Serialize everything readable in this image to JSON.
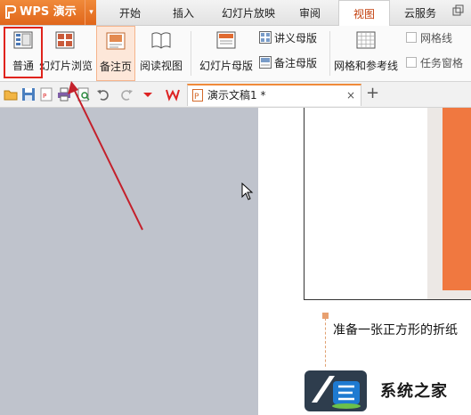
{
  "app": {
    "title": "WPS 演示",
    "accent": "#e0661b"
  },
  "tabs": [
    {
      "label": "开始"
    },
    {
      "label": "插入"
    },
    {
      "label": "幻灯片放映"
    },
    {
      "label": "审阅"
    },
    {
      "label": "视图"
    },
    {
      "label": "云服务"
    }
  ],
  "active_tab": "视图",
  "ribbon": {
    "normal": "普通",
    "slide_browse": "幻灯片浏览",
    "notes_page": "备注页",
    "reading_view": "阅读视图",
    "slide_master": "幻灯片母版",
    "handout_master": "讲义母版",
    "notes_master": "备注母版",
    "grid_guides": "网格和参考线",
    "gridlines": "网格线",
    "task_pane": "任务窗格"
  },
  "document": {
    "tab_name": "演示文稿1 *",
    "close": "×",
    "new_tab": "+"
  },
  "notes": {
    "text": "准备一张正方形的折纸"
  },
  "watermark": {
    "text": "系统之家"
  }
}
